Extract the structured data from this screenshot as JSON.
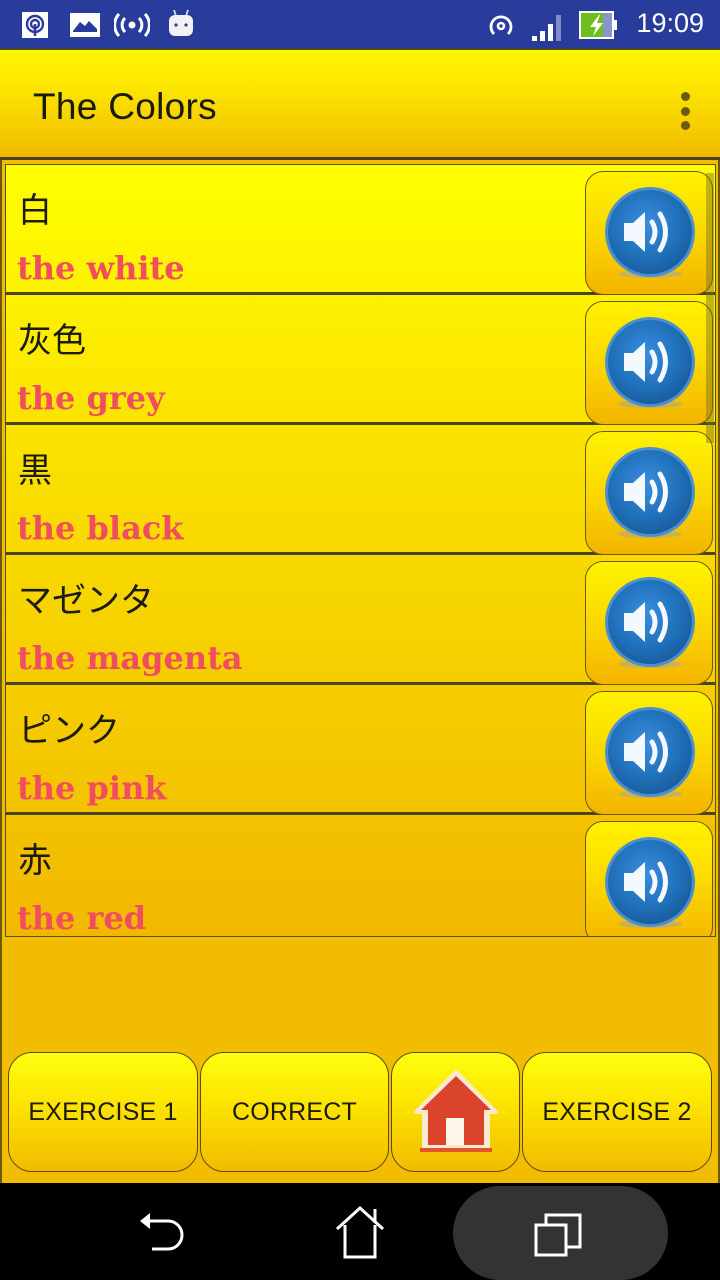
{
  "status_bar": {
    "left_icons": [
      "hotspot-icon",
      "image-icon",
      "broadcast-icon",
      "android-icon"
    ],
    "right_icons": [
      "wifi-hotspot-icon",
      "signal-icon",
      "battery-charging-icon"
    ],
    "time": "19:09"
  },
  "app_bar": {
    "title": "The Colors",
    "menu_icon": "overflow-menu-icon"
  },
  "list": {
    "items": [
      {
        "japanese": "白",
        "english": "the white",
        "audio_icon": "speaker-icon"
      },
      {
        "japanese": "灰色",
        "english": "the grey",
        "audio_icon": "speaker-icon"
      },
      {
        "japanese": "黒",
        "english": "the black",
        "audio_icon": "speaker-icon"
      },
      {
        "japanese": "マゼンタ",
        "english": "the magenta",
        "audio_icon": "speaker-icon"
      },
      {
        "japanese": "ピンク",
        "english": "the pink",
        "audio_icon": "speaker-icon"
      },
      {
        "japanese": "赤",
        "english": "the red",
        "audio_icon": "speaker-icon"
      }
    ]
  },
  "bottom_bar": {
    "exercise1_label": "EXERCISE 1",
    "correct_label": "CORRECT",
    "home_icon": "home-icon",
    "exercise2_label": "EXERCISE 2"
  },
  "nav_bar": {
    "back_icon": "back-icon",
    "home_icon": "home-outline-icon",
    "recents_icon": "recents-icon"
  },
  "colors": {
    "status_bar": "#2a3c9b",
    "app_bar_top": "#fff700",
    "app_bar_bottom": "#f0b800",
    "english_text": "#f04d60",
    "speaker_blue": "#1f6fb8"
  }
}
